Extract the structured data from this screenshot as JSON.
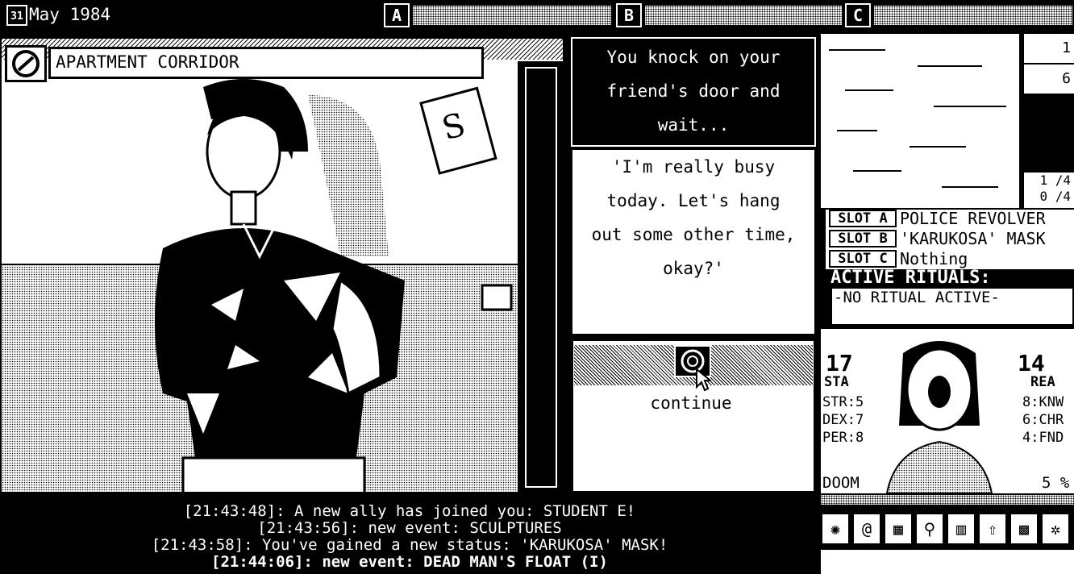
{
  "topbar": {
    "calendar_day": "31",
    "date": "May 1984",
    "slots": [
      "A",
      "B",
      "C"
    ]
  },
  "scene": {
    "title": "APARTMENT CORRIDOR"
  },
  "dialogue": {
    "narration": [
      "You knock on your",
      "friend's door and",
      "wait..."
    ],
    "speech": [
      "'I'm really busy",
      "today. Let's hang",
      "out some other time,",
      "okay?'"
    ],
    "continue_label": "continue"
  },
  "log": [
    "[21:43:48]: A new ally has joined you: STUDENT E!",
    "[21:43:56]: new event: SCULPTURES",
    "[21:43:58]: You've gained a new status: 'KARUKOSA' MASK!",
    "[21:44:06]: new event: DEAD MAN'S FLOAT (I)"
  ],
  "minimap": {
    "values": [
      "1",
      "6"
    ],
    "counters": [
      "1 /4",
      "0 /4"
    ]
  },
  "equipment": [
    {
      "slot": "SLOT A",
      "item": "POLICE REVOLVER"
    },
    {
      "slot": "SLOT B",
      "item": "'KARUKOSA' MASK"
    },
    {
      "slot": "SLOT C",
      "item": "Nothing"
    }
  ],
  "rituals": {
    "header": "ACTIVE RITUALS:",
    "status": "-NO RITUAL ACTIVE-"
  },
  "stats": {
    "sta_value": "17",
    "sta_label": "STA",
    "rea_value": "14",
    "rea_label": "REA",
    "left_attrs": [
      "STR:5",
      "DEX:7",
      "PER:8"
    ],
    "right_attrs": [
      "8:KNW",
      "6:CHR",
      "4:FND"
    ],
    "doom_label": "DOOM",
    "doom_value": "5 %"
  },
  "colors": {
    "fg": "#000000",
    "bg": "#ffffff"
  },
  "menu_icons": [
    "gear-icon",
    "spiral-icon",
    "chart-icon",
    "search-person-icon",
    "building-icon",
    "stairs-icon",
    "grid-icon",
    "settings-icon"
  ]
}
